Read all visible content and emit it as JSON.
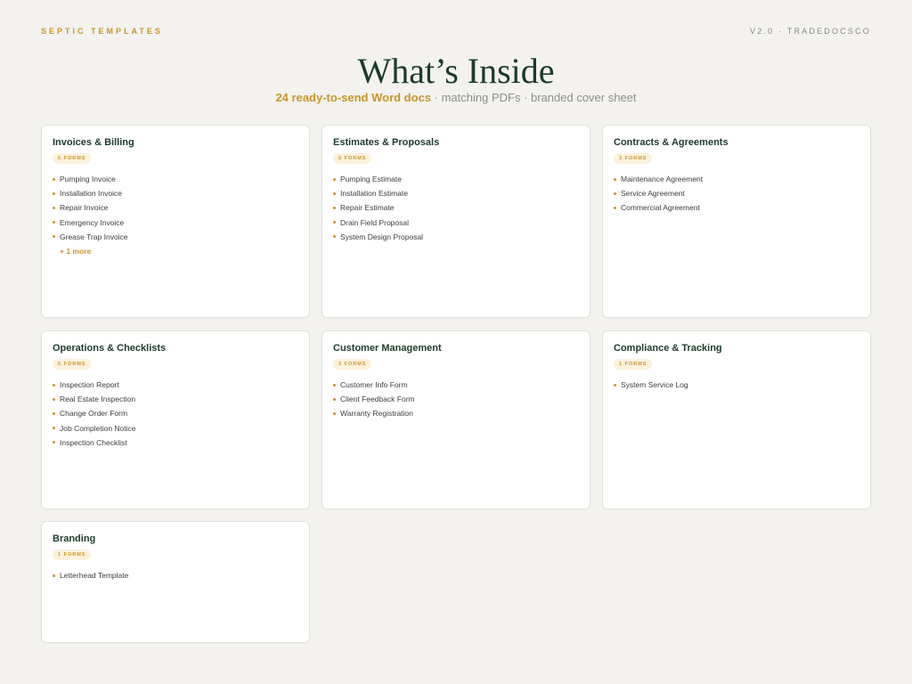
{
  "header": {
    "brand": "SEPTIC TEMPLATES",
    "version": "V2.0 · TRADEDOCSCO",
    "title": "What’s Inside",
    "subtitle_accent": "24 ready-to-send Word docs",
    "subtitle_rest": " · matching PDFs · branded cover sheet"
  },
  "categories": [
    {
      "title": "Invoices & Billing",
      "badge": "6 FORMS",
      "items": [
        "Pumping Invoice",
        "Installation Invoice",
        "Repair Invoice",
        "Emergency Invoice",
        "Grease Trap Invoice"
      ],
      "more": "+ 1 more"
    },
    {
      "title": "Estimates & Proposals",
      "badge": "5 FORMS",
      "items": [
        "Pumping Estimate",
        "Installation Estimate",
        "Repair Estimate",
        "Drain Field Proposal",
        "System Design Proposal"
      ]
    },
    {
      "title": "Contracts & Agreements",
      "badge": "3 FORMS",
      "items": [
        "Maintenance Agreement",
        "Service Agreement",
        "Commercial Agreement"
      ]
    },
    {
      "title": "Operations & Checklists",
      "badge": "5 FORMS",
      "items": [
        "Inspection Report",
        "Real Estate Inspection",
        "Change Order Form",
        "Job Completion Notice",
        "Inspection Checklist"
      ]
    },
    {
      "title": "Customer Management",
      "badge": "3 FORMS",
      "items": [
        "Customer Info Form",
        "Client Feedback Form",
        "Warranty Registration"
      ]
    },
    {
      "title": "Compliance & Tracking",
      "badge": "1 FORMS",
      "items": [
        "System Service Log"
      ]
    },
    {
      "title": "Branding",
      "badge": "1 FORMS",
      "items": [
        "Letterhead Template"
      ]
    }
  ]
}
